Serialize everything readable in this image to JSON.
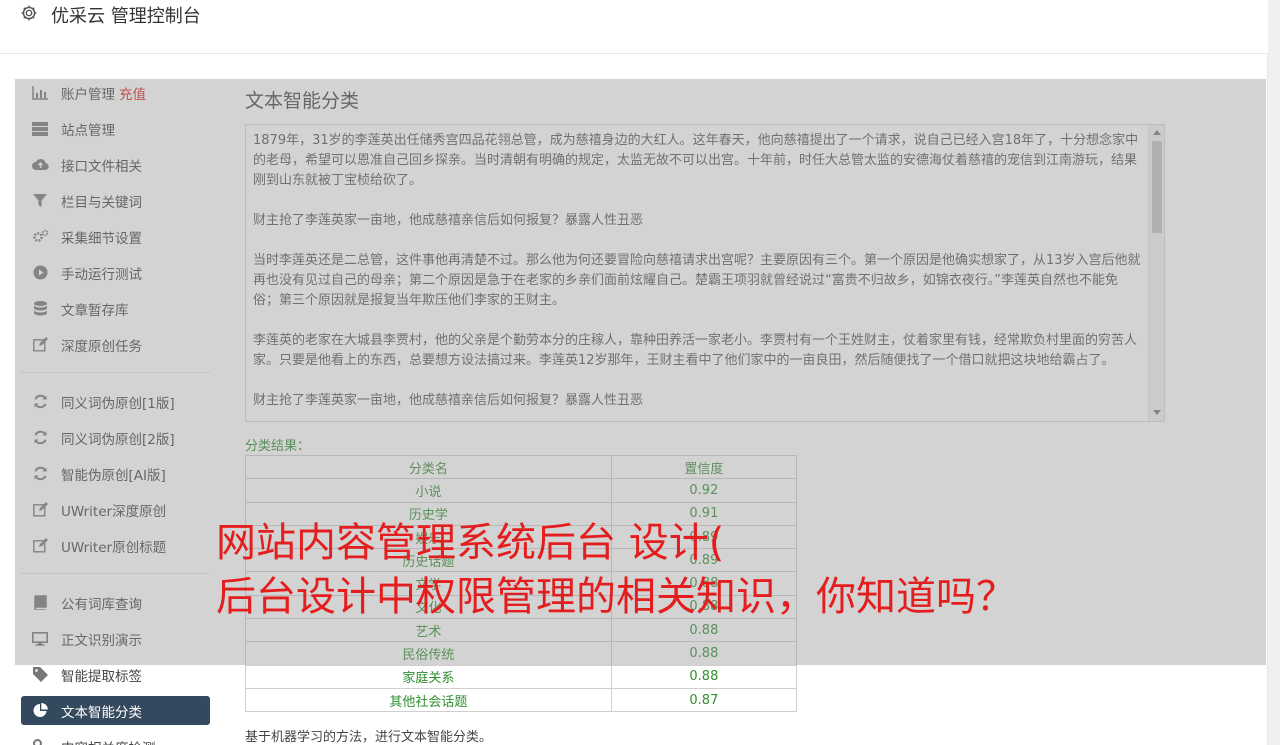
{
  "header": {
    "title": "优采云 管理控制台",
    "icon": "gear-icon"
  },
  "sidebar": {
    "items": [
      {
        "label": "账户管理",
        "badge": "充值",
        "icon": "bar-chart-icon"
      },
      {
        "label": "站点管理",
        "icon": "server-icon"
      },
      {
        "label": "接口文件相关",
        "icon": "cloud-upload-icon"
      },
      {
        "label": "栏目与关键词",
        "icon": "filter-icon"
      },
      {
        "label": "采集细节设置",
        "icon": "gears-icon"
      },
      {
        "label": "手动运行测试",
        "icon": "play-circle-icon"
      },
      {
        "label": "文章暂存库",
        "icon": "database-icon"
      },
      {
        "label": "深度原创任务",
        "icon": "edit-icon"
      },
      {
        "label": "同义词伪原创[1版]",
        "icon": "refresh-icon"
      },
      {
        "label": "同义词伪原创[2版]",
        "icon": "refresh-icon"
      },
      {
        "label": "智能伪原创[AI版]",
        "icon": "refresh-icon"
      },
      {
        "label": "UWriter深度原创",
        "icon": "edit-icon"
      },
      {
        "label": "UWriter原创标题",
        "icon": "edit-icon"
      },
      {
        "label": "公有词库查询",
        "icon": "book-icon"
      },
      {
        "label": "正文识别演示",
        "icon": "monitor-icon"
      },
      {
        "label": "智能提取标签",
        "icon": "tag-icon"
      },
      {
        "label": "文本智能分类",
        "icon": "pie-chart-icon"
      },
      {
        "label": "内容相关度检测",
        "icon": "key-icon"
      }
    ]
  },
  "main": {
    "title": "文本智能分类",
    "text_paragraphs": [
      "1879年，31岁的李莲英出任储秀宫四品花翎总管，成为慈禧身边的大红人。这年春天，他向慈禧提出了一个请求，说自己已经入宫18年了，十分想念家中的老母，希望可以恩准自己回乡探亲。当时清朝有明确的规定，太监无故不可以出宫。十年前，时任大总管太监的安德海仗着慈禧的宠信到江南游玩，结果刚到山东就被丁宝桢给砍了。",
      "财主抢了李莲英家一亩地，他成慈禧亲信后如何报复？暴露人性丑恶",
      "当时李莲英还是二总管，这件事他再清楚不过。那么他为何还要冒险向慈禧请求出宫呢？主要原因有三个。第一个原因是他确实想家了，从13岁入宫后他就再也没有见过自己的母亲；第二个原因是急于在老家的乡亲们面前炫耀自己。楚霸王项羽就曾经说过“富贵不归故乡，如锦衣夜行。”李莲英自然也不能免俗；第三个原因就是报复当年欺压他们李家的王财主。",
      "李莲英的老家在大城县李贾村，他的父亲是个勤劳本分的庄稼人，靠种田养活一家老小。李贾村有一个王姓财主，仗着家里有钱，经常欺负村里面的穷苦人家。只要是他看上的东西，总要想方设法搞过来。李莲英12岁那年，王财主看中了他们家中的一亩良田，然后随便找了一个借口就把这块地给霸占了。",
      "财主抢了李莲英家一亩地，他成慈禧亲信后如何报复？暴露人性丑恶"
    ],
    "result_label": "分类结果：",
    "table": {
      "headers": [
        "分类名",
        "置信度"
      ],
      "rows": [
        [
          "小说",
          "0.92"
        ],
        [
          "历史学",
          "0.91"
        ],
        [
          "娱乐",
          "0.89"
        ],
        [
          "历史话题",
          "0.89"
        ],
        [
          "文学",
          "0.88"
        ],
        [
          "文化",
          "0.88"
        ],
        [
          "艺术",
          "0.88"
        ],
        [
          "民俗传统",
          "0.88"
        ],
        [
          "家庭关系",
          "0.88"
        ],
        [
          "其他社会话题",
          "0.87"
        ]
      ]
    },
    "footnote": "基于机器学习的方法，进行文本智能分类。"
  },
  "banner": {
    "line1": "网站内容管理系统后台 设计(",
    "line2": "后台设计中权限管理的相关知识，你知道吗？"
  },
  "colors": {
    "active_nav": "#34495e",
    "banner_red": "#e41e1e",
    "result_green": "#2f8f2f"
  }
}
